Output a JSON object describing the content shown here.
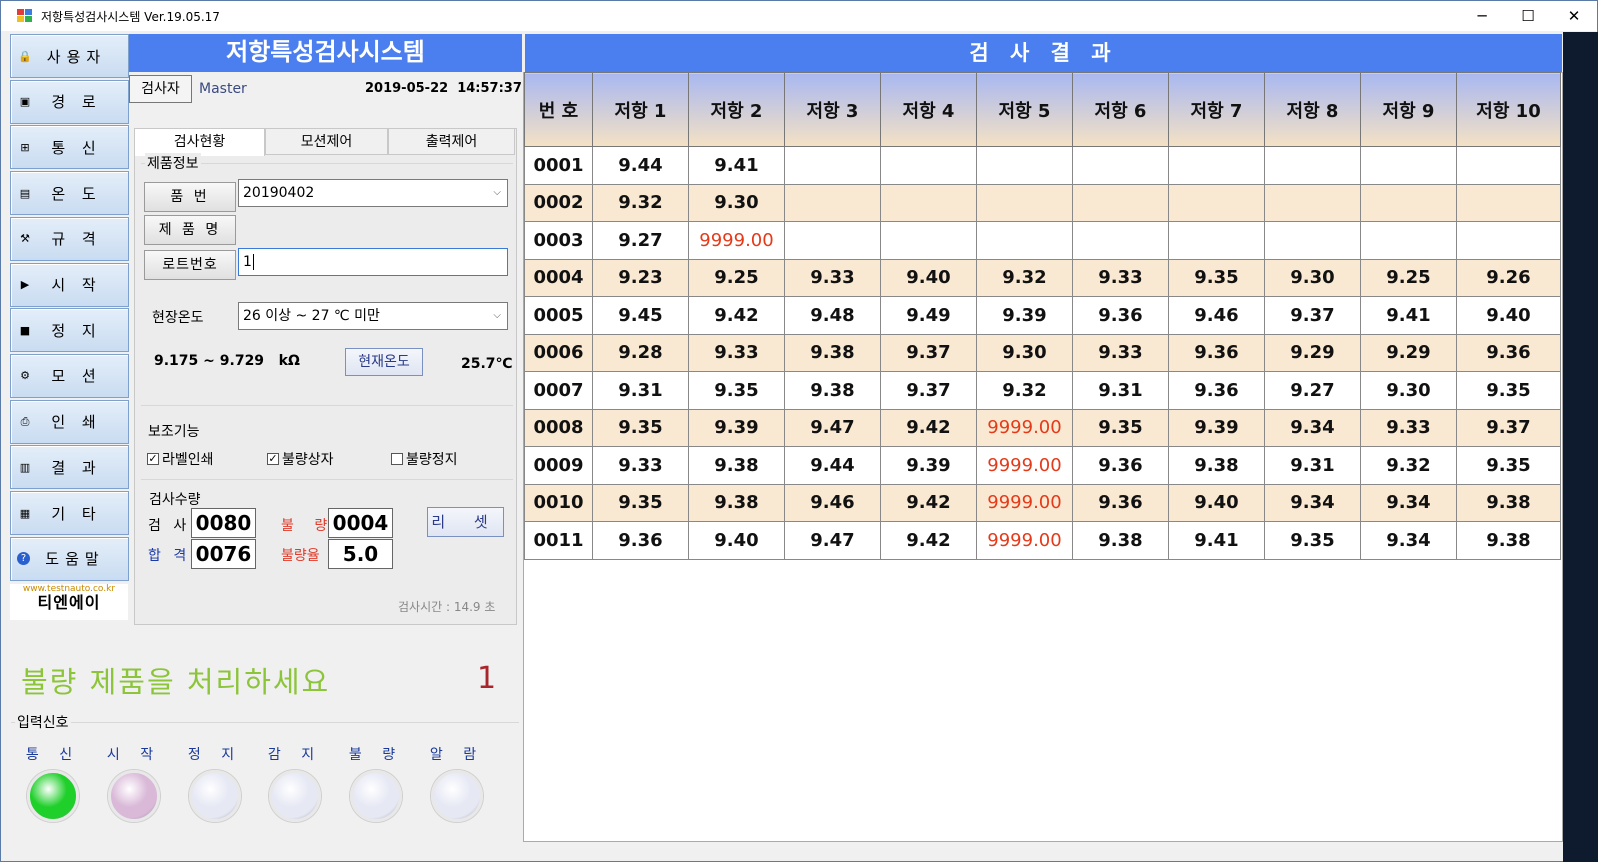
{
  "window": {
    "title": "저항특성검사시스템 Ver.19.05.17",
    "controls": [
      "─",
      "☐",
      "✕"
    ]
  },
  "nav": [
    {
      "label": "사용자",
      "icon": "lock-icon"
    },
    {
      "label": "경 로",
      "icon": "path-icon"
    },
    {
      "label": "통 신",
      "icon": "network-icon"
    },
    {
      "label": "온 도",
      "icon": "temperature-icon"
    },
    {
      "label": "규 격",
      "icon": "tools-icon"
    },
    {
      "label": "시 작",
      "icon": "play-icon"
    },
    {
      "label": "정 지",
      "icon": "stop-icon"
    },
    {
      "label": "모 션",
      "icon": "motion-icon"
    },
    {
      "label": "인 쇄",
      "icon": "printer-icon"
    },
    {
      "label": "결 과",
      "icon": "result-icon"
    },
    {
      "label": "기 타",
      "icon": "etc-icon"
    },
    {
      "label": "도움말",
      "icon": "help-icon"
    }
  ],
  "logo": {
    "url": "www.testnauto.co.kr",
    "company": "티엔에이"
  },
  "main": {
    "title": "저항특성검사시스템",
    "inspector_label": "검사자",
    "inspector_name": "Master",
    "date": "2019-05-22",
    "time": "14:57:37",
    "tabs": [
      "검사현황",
      "모션제어",
      "출력제어"
    ],
    "product": {
      "group_label": "제품정보",
      "part_no_label": "품  번",
      "part_no_value": "20190402",
      "product_name_label": "제 품 명",
      "lot_label": "로트번호",
      "lot_value": "1"
    },
    "temperature": {
      "label": "현장온도",
      "range_value": "26 이상 ~ 27 ℃ 미만",
      "spec_text": "9.175 ~ 9.729",
      "unit": "kΩ",
      "current_button": "현재온도",
      "current_value": "25.7℃"
    },
    "aux": {
      "group_label": "보조기능",
      "label_print": "라벨인쇄",
      "label_print_checked": true,
      "defect_box": "불량상자",
      "defect_box_checked": true,
      "defect_stop": "불량정지",
      "defect_stop_checked": false
    },
    "counts": {
      "group_label": "검사수량",
      "inspect_label": "검 사",
      "inspect_value": "0080",
      "defect_label": "불 량",
      "defect_value": "0004",
      "pass_label": "합 격",
      "pass_value": "0076",
      "defect_rate_label": "불량율",
      "defect_rate_value": "5.0",
      "reset_label": "리 셋"
    },
    "inspect_time": "검사시간 : 14.9 초",
    "message": "불량 제품을 처리하세요",
    "message_number": "1",
    "signals_label": "입력신호",
    "signals": [
      {
        "label": "통 신",
        "color": "#1fcf2a"
      },
      {
        "label": "시 작",
        "color": "#d9b8d8"
      },
      {
        "label": "정 지",
        "color": "#e6e8f4"
      },
      {
        "label": "감 지",
        "color": "#e6e8f4"
      },
      {
        "label": "불 량",
        "color": "#e6e8f4"
      },
      {
        "label": "알 람",
        "color": "#e6e8f4"
      }
    ]
  },
  "results": {
    "title": "검 사 결 과",
    "headers": [
      "번  호",
      "저항 1",
      "저항 2",
      "저항 3",
      "저항 4",
      "저항 5",
      "저항 6",
      "저항 7",
      "저항 8",
      "저항 9",
      "저항 10"
    ],
    "rows": [
      [
        "0001",
        "9.44",
        "9.41",
        "",
        "",
        "",
        "",
        "",
        "",
        "",
        ""
      ],
      [
        "0002",
        "9.32",
        "9.30",
        "",
        "",
        "",
        "",
        "",
        "",
        "",
        ""
      ],
      [
        "0003",
        "9.27",
        "9999.00",
        "",
        "",
        "",
        "",
        "",
        "",
        "",
        ""
      ],
      [
        "0004",
        "9.23",
        "9.25",
        "9.33",
        "9.40",
        "9.32",
        "9.33",
        "9.35",
        "9.30",
        "9.25",
        "9.26"
      ],
      [
        "0005",
        "9.45",
        "9.42",
        "9.48",
        "9.49",
        "9.39",
        "9.36",
        "9.46",
        "9.37",
        "9.41",
        "9.40"
      ],
      [
        "0006",
        "9.28",
        "9.33",
        "9.38",
        "9.37",
        "9.30",
        "9.33",
        "9.36",
        "9.29",
        "9.29",
        "9.36"
      ],
      [
        "0007",
        "9.31",
        "9.35",
        "9.38",
        "9.37",
        "9.32",
        "9.31",
        "9.36",
        "9.27",
        "9.30",
        "9.35"
      ],
      [
        "0008",
        "9.35",
        "9.39",
        "9.47",
        "9.42",
        "9999.00",
        "9.35",
        "9.39",
        "9.34",
        "9.33",
        "9.37"
      ],
      [
        "0009",
        "9.33",
        "9.38",
        "9.44",
        "9.39",
        "9999.00",
        "9.36",
        "9.38",
        "9.31",
        "9.32",
        "9.35"
      ],
      [
        "0010",
        "9.35",
        "9.38",
        "9.46",
        "9.42",
        "9999.00",
        "9.36",
        "9.40",
        "9.34",
        "9.34",
        "9.38"
      ],
      [
        "0011",
        "9.36",
        "9.40",
        "9.47",
        "9.42",
        "9999.00",
        "9.38",
        "9.41",
        "9.35",
        "9.34",
        "9.38"
      ]
    ],
    "fail_value": "9999.00",
    "fail_color": "#e53a1a",
    "even_row_color": "#fae9d2"
  }
}
